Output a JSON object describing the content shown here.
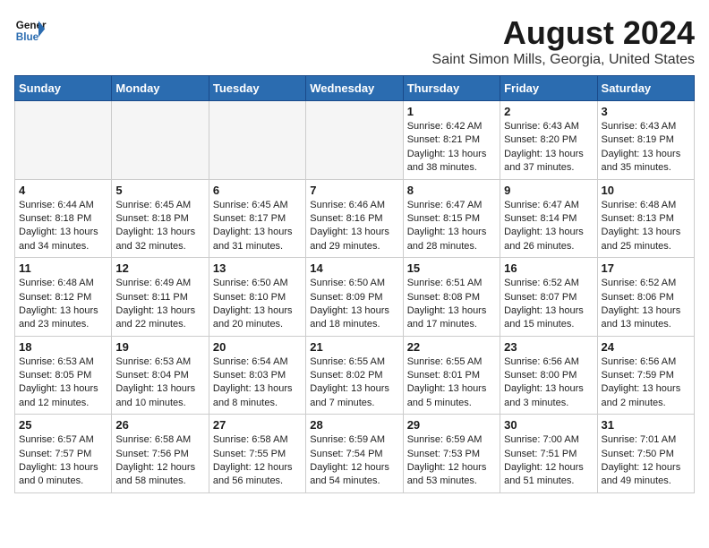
{
  "logo": {
    "line1": "General",
    "line2": "Blue"
  },
  "title": "August 2024",
  "location": "Saint Simon Mills, Georgia, United States",
  "days_of_week": [
    "Sunday",
    "Monday",
    "Tuesday",
    "Wednesday",
    "Thursday",
    "Friday",
    "Saturday"
  ],
  "weeks": [
    [
      {
        "day": "",
        "info": ""
      },
      {
        "day": "",
        "info": ""
      },
      {
        "day": "",
        "info": ""
      },
      {
        "day": "",
        "info": ""
      },
      {
        "day": "1",
        "info": "Sunrise: 6:42 AM\nSunset: 8:21 PM\nDaylight: 13 hours\nand 38 minutes."
      },
      {
        "day": "2",
        "info": "Sunrise: 6:43 AM\nSunset: 8:20 PM\nDaylight: 13 hours\nand 37 minutes."
      },
      {
        "day": "3",
        "info": "Sunrise: 6:43 AM\nSunset: 8:19 PM\nDaylight: 13 hours\nand 35 minutes."
      }
    ],
    [
      {
        "day": "4",
        "info": "Sunrise: 6:44 AM\nSunset: 8:18 PM\nDaylight: 13 hours\nand 34 minutes."
      },
      {
        "day": "5",
        "info": "Sunrise: 6:45 AM\nSunset: 8:18 PM\nDaylight: 13 hours\nand 32 minutes."
      },
      {
        "day": "6",
        "info": "Sunrise: 6:45 AM\nSunset: 8:17 PM\nDaylight: 13 hours\nand 31 minutes."
      },
      {
        "day": "7",
        "info": "Sunrise: 6:46 AM\nSunset: 8:16 PM\nDaylight: 13 hours\nand 29 minutes."
      },
      {
        "day": "8",
        "info": "Sunrise: 6:47 AM\nSunset: 8:15 PM\nDaylight: 13 hours\nand 28 minutes."
      },
      {
        "day": "9",
        "info": "Sunrise: 6:47 AM\nSunset: 8:14 PM\nDaylight: 13 hours\nand 26 minutes."
      },
      {
        "day": "10",
        "info": "Sunrise: 6:48 AM\nSunset: 8:13 PM\nDaylight: 13 hours\nand 25 minutes."
      }
    ],
    [
      {
        "day": "11",
        "info": "Sunrise: 6:48 AM\nSunset: 8:12 PM\nDaylight: 13 hours\nand 23 minutes."
      },
      {
        "day": "12",
        "info": "Sunrise: 6:49 AM\nSunset: 8:11 PM\nDaylight: 13 hours\nand 22 minutes."
      },
      {
        "day": "13",
        "info": "Sunrise: 6:50 AM\nSunset: 8:10 PM\nDaylight: 13 hours\nand 20 minutes."
      },
      {
        "day": "14",
        "info": "Sunrise: 6:50 AM\nSunset: 8:09 PM\nDaylight: 13 hours\nand 18 minutes."
      },
      {
        "day": "15",
        "info": "Sunrise: 6:51 AM\nSunset: 8:08 PM\nDaylight: 13 hours\nand 17 minutes."
      },
      {
        "day": "16",
        "info": "Sunrise: 6:52 AM\nSunset: 8:07 PM\nDaylight: 13 hours\nand 15 minutes."
      },
      {
        "day": "17",
        "info": "Sunrise: 6:52 AM\nSunset: 8:06 PM\nDaylight: 13 hours\nand 13 minutes."
      }
    ],
    [
      {
        "day": "18",
        "info": "Sunrise: 6:53 AM\nSunset: 8:05 PM\nDaylight: 13 hours\nand 12 minutes."
      },
      {
        "day": "19",
        "info": "Sunrise: 6:53 AM\nSunset: 8:04 PM\nDaylight: 13 hours\nand 10 minutes."
      },
      {
        "day": "20",
        "info": "Sunrise: 6:54 AM\nSunset: 8:03 PM\nDaylight: 13 hours\nand 8 minutes."
      },
      {
        "day": "21",
        "info": "Sunrise: 6:55 AM\nSunset: 8:02 PM\nDaylight: 13 hours\nand 7 minutes."
      },
      {
        "day": "22",
        "info": "Sunrise: 6:55 AM\nSunset: 8:01 PM\nDaylight: 13 hours\nand 5 minutes."
      },
      {
        "day": "23",
        "info": "Sunrise: 6:56 AM\nSunset: 8:00 PM\nDaylight: 13 hours\nand 3 minutes."
      },
      {
        "day": "24",
        "info": "Sunrise: 6:56 AM\nSunset: 7:59 PM\nDaylight: 13 hours\nand 2 minutes."
      }
    ],
    [
      {
        "day": "25",
        "info": "Sunrise: 6:57 AM\nSunset: 7:57 PM\nDaylight: 13 hours\nand 0 minutes."
      },
      {
        "day": "26",
        "info": "Sunrise: 6:58 AM\nSunset: 7:56 PM\nDaylight: 12 hours\nand 58 minutes."
      },
      {
        "day": "27",
        "info": "Sunrise: 6:58 AM\nSunset: 7:55 PM\nDaylight: 12 hours\nand 56 minutes."
      },
      {
        "day": "28",
        "info": "Sunrise: 6:59 AM\nSunset: 7:54 PM\nDaylight: 12 hours\nand 54 minutes."
      },
      {
        "day": "29",
        "info": "Sunrise: 6:59 AM\nSunset: 7:53 PM\nDaylight: 12 hours\nand 53 minutes."
      },
      {
        "day": "30",
        "info": "Sunrise: 7:00 AM\nSunset: 7:51 PM\nDaylight: 12 hours\nand 51 minutes."
      },
      {
        "day": "31",
        "info": "Sunrise: 7:01 AM\nSunset: 7:50 PM\nDaylight: 12 hours\nand 49 minutes."
      }
    ]
  ]
}
